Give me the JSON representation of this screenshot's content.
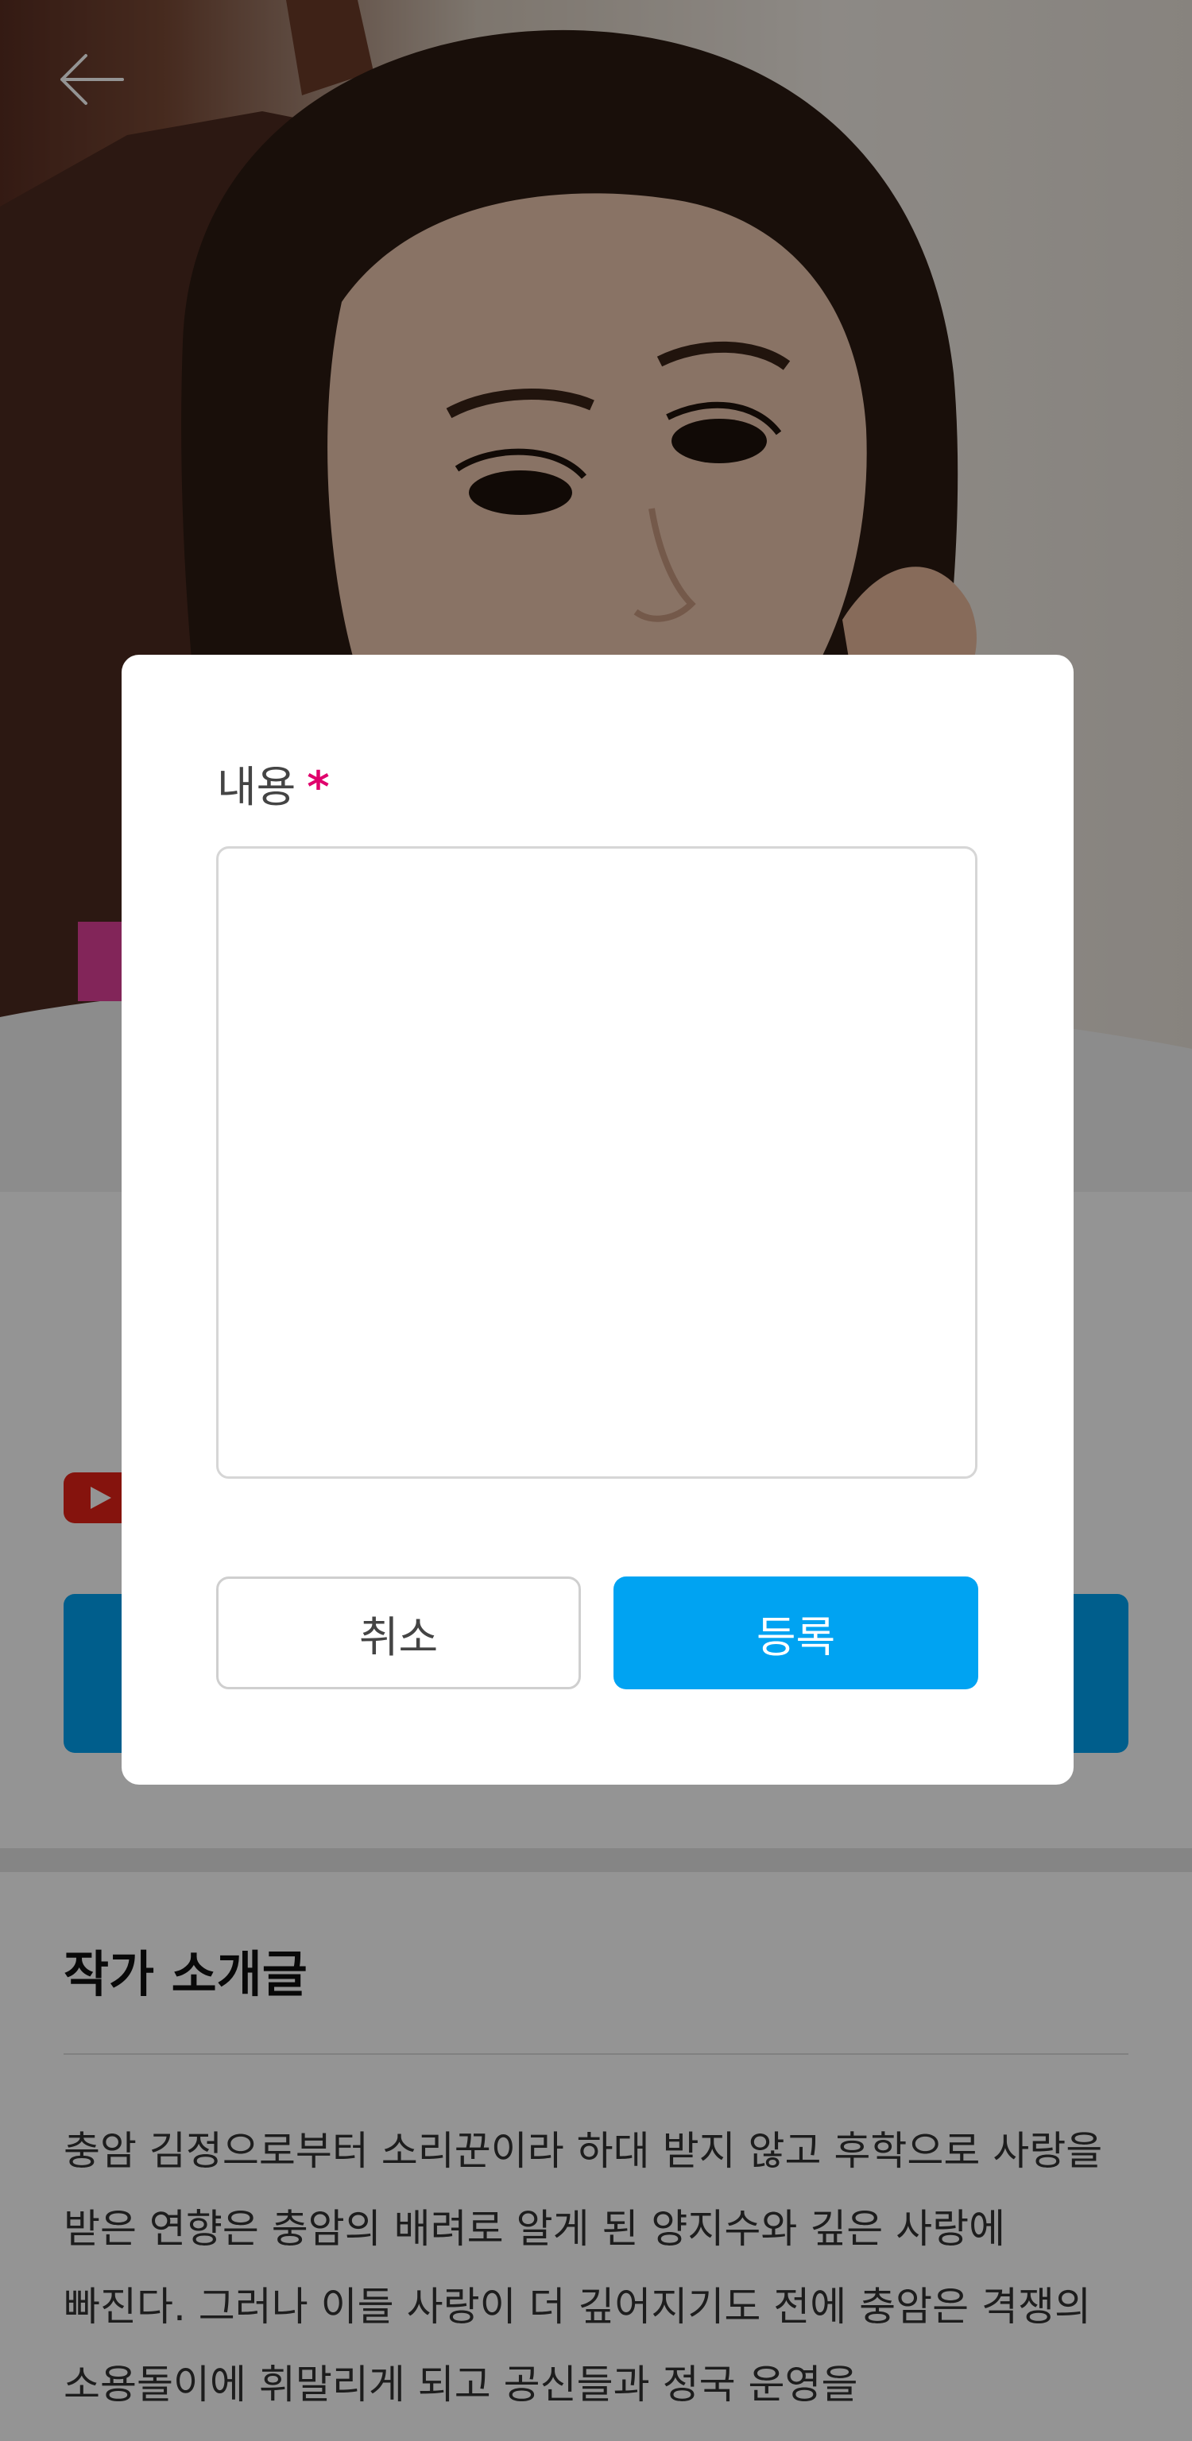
{
  "hero": {
    "back_icon": "arrow-left-icon",
    "banner_pink_text": "",
    "banner_yellow_text": ""
  },
  "author_section": {
    "title": "",
    "comment_label": "",
    "youtube_icon": "youtube-icon",
    "write_button_label": ""
  },
  "intro_section": {
    "heading": "작가 소개글",
    "body": "충암 김정으로부터 소리꾼이라 하대 받지 않고 후학으로 사랑을 받은 연향은 충암의 배려로 알게 된 양지수와 깊은 사랑에 빠진다. 그러나 이들 사랑이 더 깊어지기도 전에 충암은 격쟁의 소용돌이에 휘말리게 되고 공신들과 정국 운영을"
  },
  "modal": {
    "field_label": "내용",
    "required_mark": "*",
    "textarea_value": "",
    "cancel_label": "취소",
    "submit_label": "등록"
  },
  "colors": {
    "accent_blue": "#00a3f2",
    "required_pink": "#e0006c",
    "banner_pink": "#e0409a",
    "banner_yellow": "#f5e400",
    "overlay": "rgba(0,0,0,0.42)"
  }
}
